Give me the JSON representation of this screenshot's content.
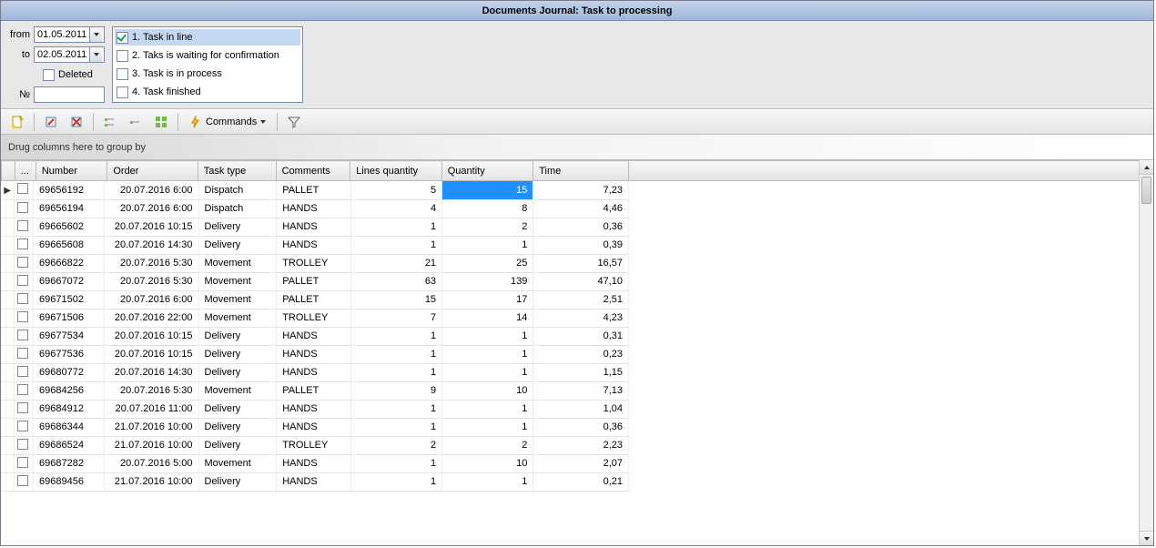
{
  "title": "Documents Journal: Task to processing",
  "filters": {
    "from_label": "from",
    "to_label": "to",
    "from_value": "01.05.2011",
    "to_value": "02.05.2011",
    "deleted_label": "Deleted",
    "num_label": "№",
    "num_value": ""
  },
  "statuses": [
    {
      "label": "1. Task in line",
      "checked": true,
      "selected": true
    },
    {
      "label": "2. Taks is waiting for confirmation",
      "checked": false,
      "selected": false
    },
    {
      "label": "3. Task is in process",
      "checked": false,
      "selected": false
    },
    {
      "label": "4. Task finished",
      "checked": false,
      "selected": false
    }
  ],
  "toolbar": {
    "commands_label": "Commands"
  },
  "group_hint": "Drug columns here to group by",
  "columns": {
    "first": "...",
    "number": "Number",
    "order": "Order",
    "tasktype": "Task type",
    "comments": "Comments",
    "linesqty": "Lines quantity",
    "quantity": "Quantity",
    "time": "Time"
  },
  "rows": [
    {
      "number": "69656192",
      "order": "20.07.2016 6:00",
      "tasktype": "Dispatch",
      "comments": "PALLET",
      "linesqty": "5",
      "quantity": "15",
      "time": "7,23",
      "sel": true,
      "ptr": true
    },
    {
      "number": "69656194",
      "order": "20.07.2016 6:00",
      "tasktype": "Dispatch",
      "comments": "HANDS",
      "linesqty": "4",
      "quantity": "8",
      "time": "4,46"
    },
    {
      "number": "69665602",
      "order": "20.07.2016 10:15",
      "tasktype": "Delivery",
      "comments": "HANDS",
      "linesqty": "1",
      "quantity": "2",
      "time": "0,36"
    },
    {
      "number": "69665608",
      "order": "20.07.2016 14:30",
      "tasktype": "Delivery",
      "comments": "HANDS",
      "linesqty": "1",
      "quantity": "1",
      "time": "0,39"
    },
    {
      "number": "69666822",
      "order": "20.07.2016 5:30",
      "tasktype": "Movement",
      "comments": "TROLLEY",
      "linesqty": "21",
      "quantity": "25",
      "time": "16,57"
    },
    {
      "number": "69667072",
      "order": "20.07.2016 5:30",
      "tasktype": "Movement",
      "comments": "PALLET",
      "linesqty": "63",
      "quantity": "139",
      "time": "47,10"
    },
    {
      "number": "69671502",
      "order": "20.07.2016 6:00",
      "tasktype": "Movement",
      "comments": "PALLET",
      "linesqty": "15",
      "quantity": "17",
      "time": "2,51"
    },
    {
      "number": "69671506",
      "order": "20.07.2016 22:00",
      "tasktype": "Movement",
      "comments": "TROLLEY",
      "linesqty": "7",
      "quantity": "14",
      "time": "4,23"
    },
    {
      "number": "69677534",
      "order": "20.07.2016 10:15",
      "tasktype": "Delivery",
      "comments": "HANDS",
      "linesqty": "1",
      "quantity": "1",
      "time": "0,31"
    },
    {
      "number": "69677536",
      "order": "20.07.2016 10:15",
      "tasktype": "Delivery",
      "comments": "HANDS",
      "linesqty": "1",
      "quantity": "1",
      "time": "0,23"
    },
    {
      "number": "69680772",
      "order": "20.07.2016 14:30",
      "tasktype": "Delivery",
      "comments": "HANDS",
      "linesqty": "1",
      "quantity": "1",
      "time": "1,15"
    },
    {
      "number": "69684256",
      "order": "20.07.2016 5:30",
      "tasktype": "Movement",
      "comments": "PALLET",
      "linesqty": "9",
      "quantity": "10",
      "time": "7,13"
    },
    {
      "number": "69684912",
      "order": "20.07.2016 11:00",
      "tasktype": "Delivery",
      "comments": "HANDS",
      "linesqty": "1",
      "quantity": "1",
      "time": "1,04"
    },
    {
      "number": "69686344",
      "order": "21.07.2016 10:00",
      "tasktype": "Delivery",
      "comments": "HANDS",
      "linesqty": "1",
      "quantity": "1",
      "time": "0,36"
    },
    {
      "number": "69686524",
      "order": "21.07.2016 10:00",
      "tasktype": "Delivery",
      "comments": "TROLLEY",
      "linesqty": "2",
      "quantity": "2",
      "time": "2,23"
    },
    {
      "number": "69687282",
      "order": "20.07.2016 5:00",
      "tasktype": "Movement",
      "comments": "HANDS",
      "linesqty": "1",
      "quantity": "10",
      "time": "2,07"
    },
    {
      "number": "69689456",
      "order": "21.07.2016 10:00",
      "tasktype": "Delivery",
      "comments": "HANDS",
      "linesqty": "1",
      "quantity": "1",
      "time": "0,21"
    }
  ]
}
